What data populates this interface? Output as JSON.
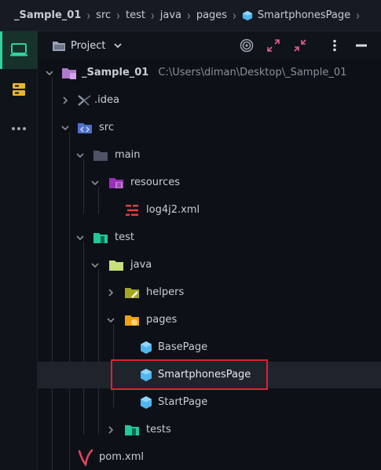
{
  "breadcrumb": {
    "items": [
      "_Sample_01",
      "src",
      "test",
      "java",
      "pages",
      "SmartphonesPage"
    ]
  },
  "toolwindow": {
    "title": "Project"
  },
  "tree": {
    "root": {
      "label": "_Sample_01",
      "path": "C:\\Users\\diman\\Desktop\\_Sample_01"
    },
    "idea": ".idea",
    "src": "src",
    "main": "main",
    "resources": "resources",
    "log4j2": "log4j2.xml",
    "test": "test",
    "java": "java",
    "helpers": "helpers",
    "pages": "pages",
    "basepage": "BasePage",
    "smartphonespage": "SmartphonesPage",
    "startpage": "StartPage",
    "tests": "tests",
    "pom": "pom.xml"
  },
  "colors": {
    "accent": "#2ed3a0",
    "highlight": "#e3202f",
    "folder": "#5a5f78",
    "class_icon": "#4fb6f0"
  }
}
